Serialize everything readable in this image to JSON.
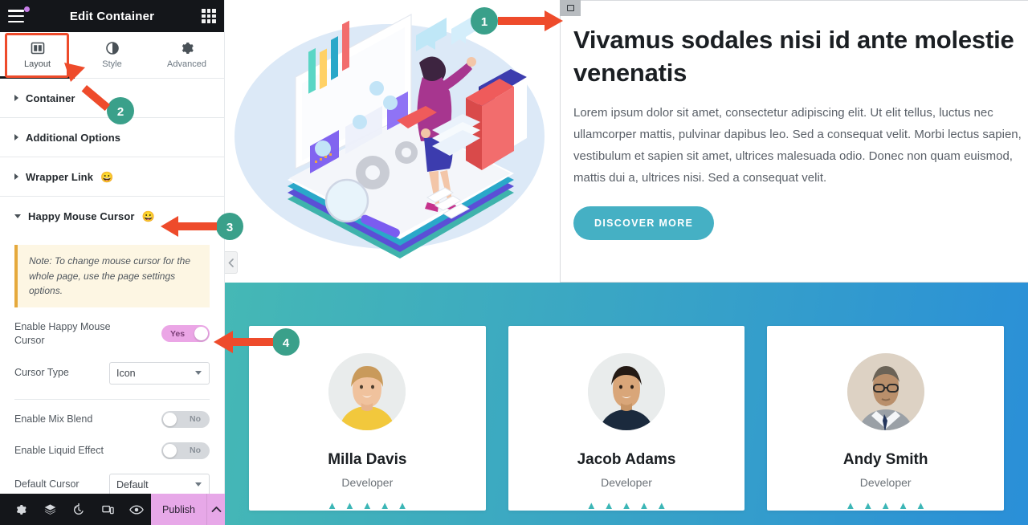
{
  "panel": {
    "title": "Edit Container",
    "menu_icon": "hamburger-icon",
    "apps_icon": "grid-icon",
    "tabs": [
      {
        "label": "Layout",
        "icon": "layout-columns-icon",
        "active": true
      },
      {
        "label": "Style",
        "icon": "contrast-circle-icon",
        "active": false
      },
      {
        "label": "Advanced",
        "icon": "gear-icon",
        "active": false
      }
    ],
    "sections": [
      {
        "title": "Container",
        "emoji": "",
        "open": false
      },
      {
        "title": "Additional Options",
        "emoji": "",
        "open": false
      },
      {
        "title": "Wrapper Link",
        "emoji": "😀",
        "open": false
      },
      {
        "title": "Happy Mouse Cursor",
        "emoji": "😀",
        "open": true
      }
    ],
    "note": "Note: To change mouse cursor for the whole page, use the page settings options.",
    "controls": [
      {
        "label": "Enable Happy Mouse Cursor",
        "type": "switch",
        "value": "Yes",
        "on": true
      },
      {
        "label": "Cursor Type",
        "type": "select",
        "value": "Icon"
      },
      {
        "label": "Enable Mix Blend",
        "type": "switch",
        "value": "No",
        "on": false
      },
      {
        "label": "Enable Liquid Effect",
        "type": "switch",
        "value": "No",
        "on": false
      },
      {
        "label": "Default Cursor",
        "type": "select",
        "value": "Default"
      }
    ],
    "footer": {
      "icons": [
        {
          "name": "settings-gear-icon"
        },
        {
          "name": "navigator-layers-icon"
        },
        {
          "name": "history-icon"
        },
        {
          "name": "responsive-mode-icon"
        },
        {
          "name": "preview-eye-icon"
        }
      ],
      "publish_label": "Publish",
      "publish_color": "#e7a8e8",
      "chevron_icon": "chevron-up-icon"
    }
  },
  "canvas": {
    "collapse_icon": "chevron-left-icon",
    "hero": {
      "illustration": "isometric-woman-laptop-books-illustration",
      "heading": "Vivamus sodales nisi id ante molestie venenatis",
      "paragraph": "Lorem ipsum dolor sit amet, consectetur adipiscing elit. Ut elit tellus, luctus nec ullamcorper mattis, pulvinar dapibus leo. Sed a consequat velit. Morbi lectus sapien, vestibulum et sapien sit amet, ultrices malesuada odio. Donec non quam euismod, mattis dui a, ultrices nisi. Sed a consequat velit.",
      "cta_label": "DISCOVER MORE",
      "cta_color": "#45b0c4"
    },
    "band": {
      "gradient_from": "#45b8b5",
      "gradient_to": "#2a8fd8"
    },
    "team": [
      {
        "name": "Milla Davis",
        "role": "Developer",
        "stars": 5,
        "avatar": "woman-yellow-top-avatar"
      },
      {
        "name": "Jacob Adams",
        "role": "Developer",
        "stars": 5,
        "avatar": "man-dark-shirt-avatar"
      },
      {
        "name": "Andy Smith",
        "role": "Developer",
        "stars": 5,
        "avatar": "man-glasses-suit-avatar"
      }
    ],
    "star_color": "#3cb6b6"
  },
  "annotations": {
    "arrow_color": "#ee4b2b",
    "badge_color": "#3aa08a",
    "steps": [
      {
        "number": "1",
        "target": "container-select-handle"
      },
      {
        "number": "2",
        "target": "layout-tab"
      },
      {
        "number": "3",
        "target": "happy-mouse-cursor-section"
      },
      {
        "number": "4",
        "target": "enable-happy-mouse-cursor-toggle"
      }
    ]
  }
}
